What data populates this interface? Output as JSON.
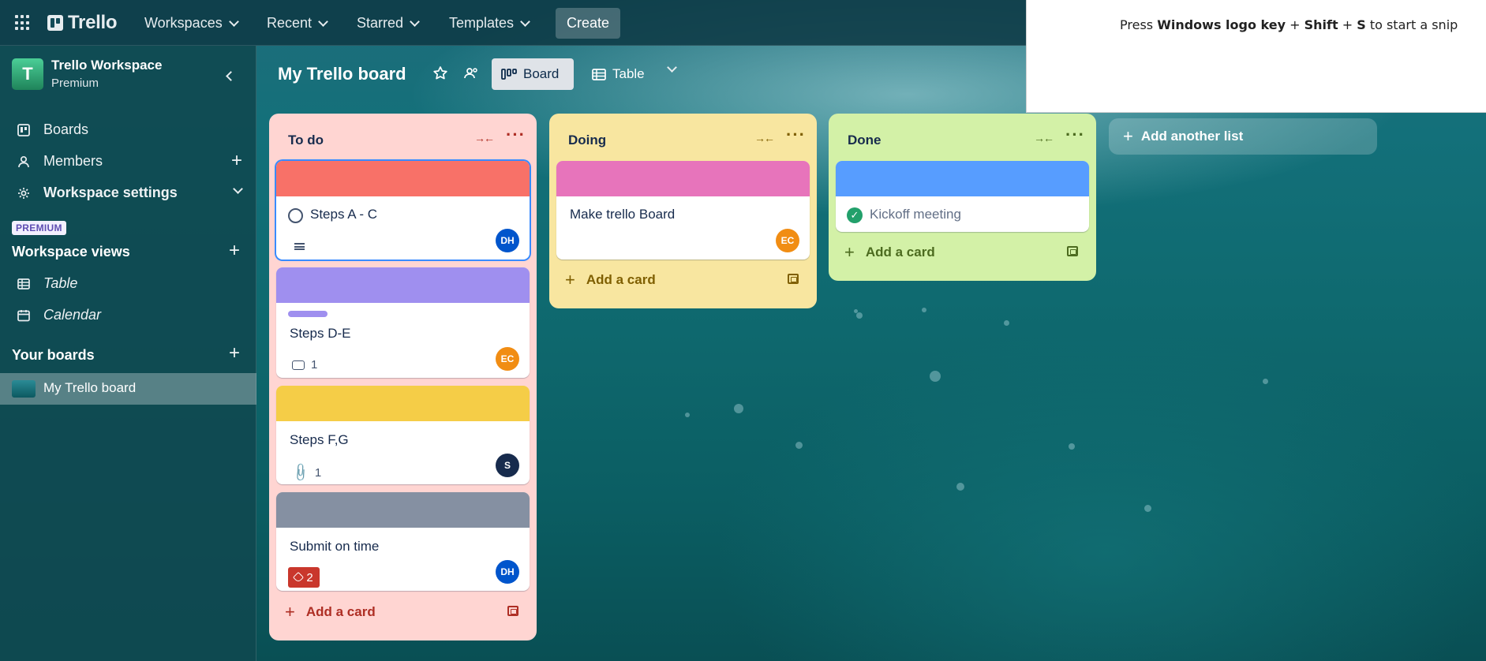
{
  "topbar": {
    "logo_text": "Trello",
    "nav": [
      "Workspaces",
      "Recent",
      "Starred",
      "Templates"
    ],
    "create_label": "Create"
  },
  "snip": {
    "prefix": "Press ",
    "keys1": "Windows logo key",
    "plus1": " + ",
    "keys2": "Shift",
    "plus2": " + ",
    "keys3": "S",
    "suffix": " to start a snip"
  },
  "sidebar": {
    "workspace_initial": "T",
    "workspace_name": "Trello Workspace",
    "workspace_plan": "Premium",
    "items": [
      {
        "label": "Boards",
        "icon": "boards-icon"
      },
      {
        "label": "Members",
        "icon": "member-icon"
      },
      {
        "label": "Workspace settings",
        "icon": "gear-icon"
      }
    ],
    "premium_badge": "PREMIUM",
    "views_title": "Workspace views",
    "views": [
      {
        "label": "Table",
        "icon": "table-icon"
      },
      {
        "label": "Calendar",
        "icon": "calendar-icon"
      }
    ],
    "boards_title": "Your boards",
    "boards": [
      {
        "label": "My Trello board"
      }
    ]
  },
  "board": {
    "title": "My Trello board",
    "view_board": "Board",
    "view_table": "Table"
  },
  "lists": [
    {
      "name": "To do",
      "color": "#ffd5d2",
      "accent": "#ae2e24",
      "add_label": "Add a card",
      "cards": [
        {
          "title": "Steps A - C",
          "cover": "#f87168",
          "avatar": "DH",
          "avatar_color": "#0055cc"
        },
        {
          "title": "Steps D-E",
          "cover": "#9f8fef",
          "avatar": "EC",
          "avatar_color": "#f18d13",
          "comments": "1"
        },
        {
          "title": "Steps F,G",
          "cover": "#f5cd47",
          "avatar": "S",
          "avatar_color": "#172b4d",
          "attachments": "1"
        },
        {
          "title": "Submit on time",
          "cover": "#8590a2",
          "avatar": "DH",
          "avatar_color": "#0055cc",
          "due": "2"
        }
      ]
    },
    {
      "name": "Doing",
      "color": "#f8e6a0",
      "accent": "#7f5f01",
      "add_label": "Add a card",
      "cards": [
        {
          "title": "Make trello Board",
          "cover": "#e774bb",
          "avatar": "EC",
          "avatar_color": "#f18d13"
        }
      ]
    },
    {
      "name": "Done",
      "color": "#d3f1a7",
      "accent": "#4c6b1f",
      "add_label": "Add a card",
      "cards": [
        {
          "title": "Kickoff meeting",
          "cover": "#579dff",
          "complete": true
        }
      ]
    }
  ],
  "add_list_label": "Add another list"
}
